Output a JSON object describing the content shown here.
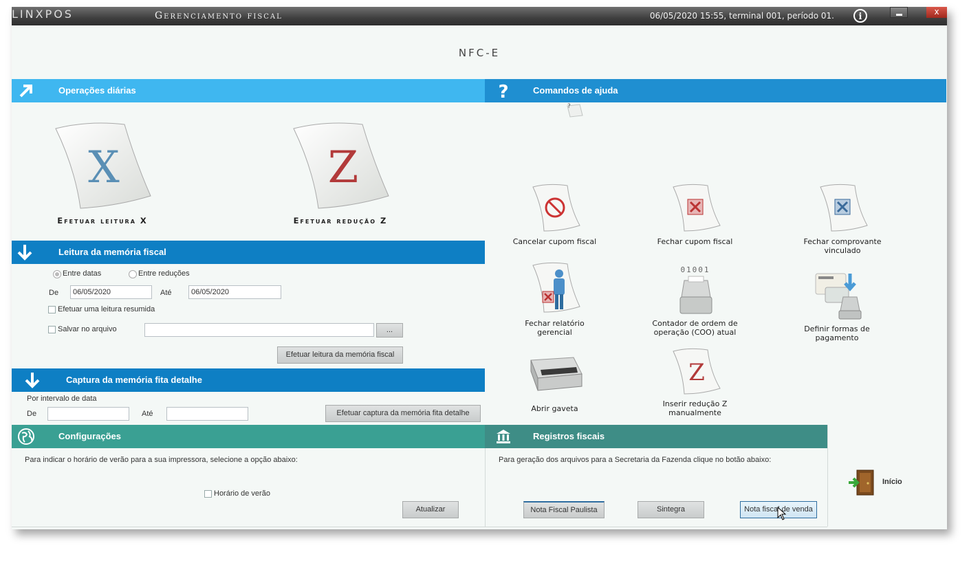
{
  "titlebar": {
    "logo": "LINXPOS",
    "title": "Gerenciamento fiscal",
    "status": "06/05/2020 15:55, terminal 001, período 01.",
    "info_icon": "info-icon",
    "close": "x"
  },
  "heading": "NFC-E",
  "daily_ops": {
    "title": "Operações diárias",
    "tiles": [
      {
        "letter": "X",
        "label": "Efetuar leitura X"
      },
      {
        "letter": "Z",
        "label": "Efetuar redução Z"
      }
    ]
  },
  "help": {
    "title": "Comandos de ajuda",
    "tiles": [
      {
        "icon": "cancel-coupon-icon",
        "label1": "Cancelar cupom fiscal",
        "label2": ""
      },
      {
        "icon": "close-coupon-icon",
        "label1": "Fechar cupom fiscal",
        "label2": ""
      },
      {
        "icon": "close-voucher-icon",
        "label1": "Fechar comprovante",
        "label2": "vinculado"
      },
      {
        "icon": "close-report-icon",
        "label1": "Fechar relatório",
        "label2": "gerencial"
      },
      {
        "icon": "printer-counter-icon",
        "label1": "Contador de ordem de",
        "label2": "operação (COO) atual",
        "counter_text": "01001"
      },
      {
        "icon": "payment-forms-icon",
        "label1": "Definir formas de",
        "label2": "pagamento"
      },
      {
        "icon": "cash-drawer-icon",
        "label1": "Abrir gaveta",
        "label2": ""
      },
      {
        "icon": "manual-z-icon",
        "label1": "Inserir redução Z",
        "label2": "manualmente",
        "letter": "Z"
      }
    ]
  },
  "memory": {
    "title": "Leitura da memória fiscal",
    "radio_dates": "Entre datas",
    "radio_reductions": "Entre reduções",
    "from_label": "De",
    "from_value": "06/05/2020",
    "to_label": "Até",
    "to_value": "06/05/2020",
    "summary_label": "Efetuar uma leitura resumida",
    "save_label": "Salvar no arquivo",
    "browse_label": "...",
    "button": "Efetuar leitura da memória fiscal"
  },
  "capture": {
    "title": "Captura da memória fita detalhe",
    "range_label": "Por intervalo de data",
    "from_label": "De",
    "to_label": "Até",
    "button": "Efetuar captura da memória fita detalhe"
  },
  "config": {
    "title": "Configurações",
    "text": "Para indicar o horário de verão para a sua impressora, selecione a opção abaixo:",
    "dst_label": "Horário de verão",
    "button": "Atualizar"
  },
  "registros": {
    "title": "Registros fiscais",
    "text": "Para geração dos arquivos para a Secretaria da Fazenda clique no botão abaixo:",
    "buttons": [
      "Nota Fiscal Paulista",
      "Sintegra",
      "Nota fiscal de venda"
    ]
  },
  "inicio": {
    "label": "Início"
  },
  "colors": {
    "bar_light": "#42b9f2",
    "bar_mid": "#1f8fd1",
    "bar_dark": "#0e7fc4",
    "config_bar": "#3aa093",
    "registros_bar": "#3e8d86"
  }
}
